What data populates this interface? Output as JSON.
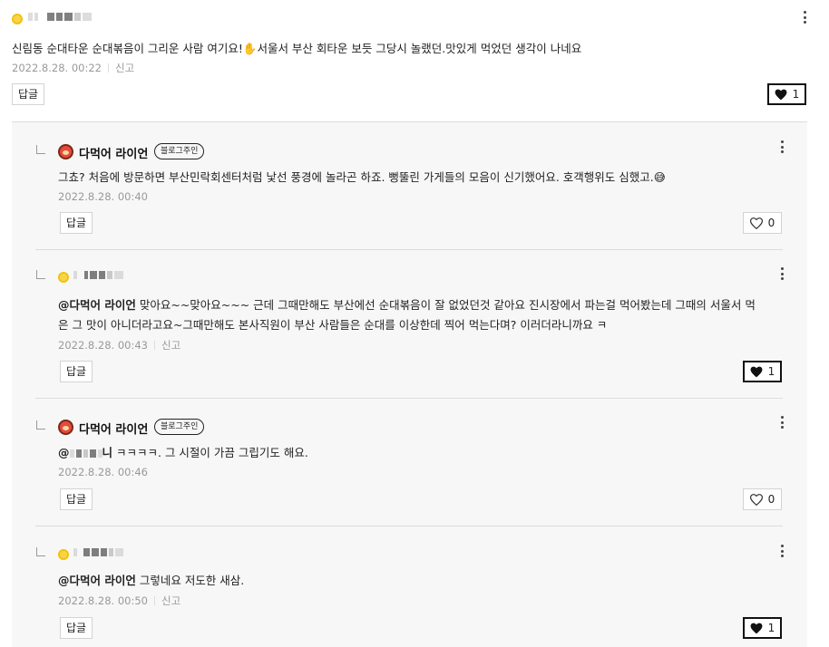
{
  "top_comment": {
    "text": "신림동 순대타운 순대볶음이 그리운 사람 여기요!✋서울서 부산 회타운 보듯 그당시 놀랬던.맛있게 먹었던 생각이 나네요",
    "date": "2022.8.28. 00:22",
    "report": "신고",
    "reply_label": "답글",
    "likes": "1",
    "liked": true,
    "avatar_icon": "user-avatar-icon"
  },
  "replies": [
    {
      "author": "다먹어 라이언",
      "badge": "블로그주인",
      "text": "그쵸? 처음에 방문하면 부산민락회센터처럼 낯선 풍경에 놀라곤 하죠. 뻥뚤린 가게들의 모음이 신기했어요. 호객행위도 심했고.😅",
      "date": "2022.8.28. 00:40",
      "reply_label": "답글",
      "likes": "0",
      "liked": false
    },
    {
      "mention": "@다먹어 라이언",
      "text_line1": "맞아요~~맞아요~~~ 근데 그때만해도 부산에선 순대볶음이 잘 없었던것 같아요 진시장에서 파는걸 먹어봤는데 그때의 서울서 먹",
      "text_line2": "은 그 맛이 아니더라고요~그때만해도 본사직원이 부산 사람들은 순대를 이상한데 찍어 먹는다며? 이러더라니까요 ㅋ",
      "date": "2022.8.28. 00:43",
      "report": "신고",
      "reply_label": "답글",
      "likes": "1",
      "liked": true
    },
    {
      "author": "다먹어 라이언",
      "badge": "블로그주인",
      "mention_suffix": "니",
      "text": "ㅋㅋㅋㅋ. 그 시절이 가끔 그립기도 해요.",
      "date": "2022.8.28. 00:46",
      "reply_label": "답글",
      "likes": "0",
      "liked": false
    },
    {
      "mention": "@다먹어 라이언",
      "text": "그렇네요 저도한 새삼.",
      "date": "2022.8.28. 00:50",
      "report": "신고",
      "reply_label": "답글",
      "likes": "1",
      "liked": true
    }
  ],
  "icons": {
    "more": "more-vertical-icon",
    "heart": "heart-icon",
    "reply_arrow": "reply-elbow-icon"
  },
  "colors": {
    "background": "#ffffff",
    "reply_background": "#f7f7f7",
    "border": "#d3d3d3",
    "meta_text": "#999999",
    "text": "#222222"
  }
}
